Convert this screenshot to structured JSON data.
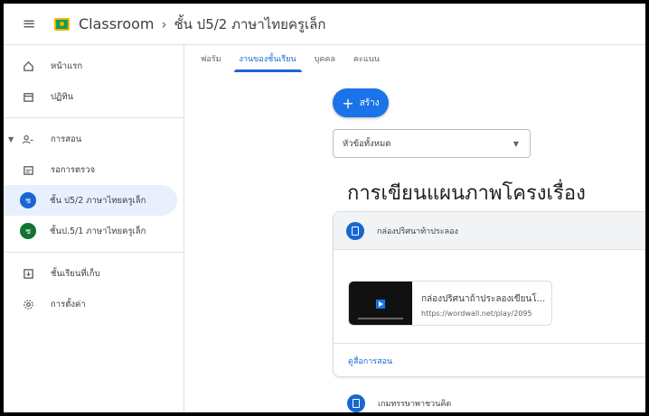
{
  "app": {
    "brand": "Classroom",
    "breadcrumb_sep": "›",
    "class_name": "ชั้น ป5/2 ภาษาไทยครูเล็ก"
  },
  "sidebar": {
    "items": [
      {
        "label": "หน้าแรก",
        "icon": "home-icon"
      },
      {
        "label": "ปฏิทิน",
        "icon": "calendar-icon"
      },
      {
        "label": "การสอน",
        "icon": "people-icon"
      },
      {
        "label": "รอการตรวจ",
        "icon": "folder-icon"
      },
      {
        "label": "ชั้น ป5/2 ภาษาไทยครูเล็ก",
        "initial": "ช",
        "color": "#1967d2"
      },
      {
        "label": "ชั้นป.5/1 ภาษาไทยครูเล็ก",
        "initial": "ช",
        "color": "#137333"
      },
      {
        "label": "ชั้นเรียนที่เก็บ",
        "icon": "archive-icon"
      },
      {
        "label": "การตั้งค่า",
        "icon": "gear-icon"
      }
    ]
  },
  "tabs": [
    {
      "label": "ฟอรัม"
    },
    {
      "label": "งานของชั้นเรียน",
      "active": true
    },
    {
      "label": "บุคคล"
    },
    {
      "label": "คะแนน"
    }
  ],
  "main": {
    "create_label": "สร้าง",
    "topic_filter": "หัวข้อทั้งหมด",
    "section_title": "การเขียนแผนภาพโครงเรื่อง",
    "assignment": {
      "title": "กล่องปริศนาท้าประลอง",
      "attachment_title": "กล่องปริศนาถ้าประลองเขียนโ...",
      "attachment_url": "https://wordwall.net/play/2095",
      "link_label": "ดูสื่อการสอน"
    },
    "next_assignment": "เกมทรรษาพาชวนคิด"
  },
  "colors": {
    "accent": "#1a73e8",
    "active_bg": "#e8f0fe"
  }
}
